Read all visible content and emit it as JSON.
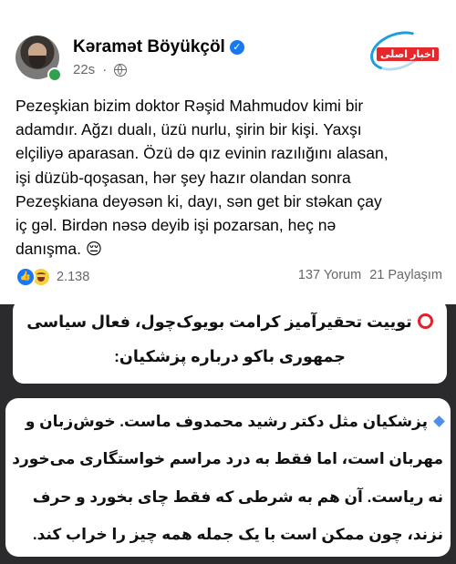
{
  "post": {
    "author": "Kəramət Böyükçöl",
    "time": "22s",
    "badge_text": "اخبار اصلی",
    "lines": [
      "Pezeşkian bizim doktor Rəşid Mahmudov kimi bir",
      "adamdır. Ağzı dualı, üzü nurlu, şirin bir kişi. Yaxşı",
      "elçiliyə aparasan. Özü də qız evinin razılığını alasan,",
      "işi düzüb-qoşasan, hər şey hazır olandan sonra",
      "Pezeşkiana deyəsən ki, dayı, sən get bir stəkan çay",
      "iç gəl. Birdən nəsə deyib işi pozarsan, heç nə",
      "danışma. 😔"
    ],
    "reaction_count": "2.138",
    "comments": "137 Yorum",
    "shares": "21 Paylaşım"
  },
  "caption": {
    "title_lines": [
      "توییت تحقیرآمیز کرامت بویوک‌چول، فعال سیاسی",
      "جمهوری باکو درباره پزشکیان:"
    ],
    "body_lines": [
      "پزشکیان مثل دکتر رشید محمدوف ماست. خوش‌زبان و",
      "مهربان است، اما فقط به درد مراسم خواستگاری می‌خورد",
      "نه ریاست. آن هم به شرطی که فقط چای بخورد و حرف",
      "نزند، چون ممکن است با یک جمله همه چیز را خراب کند."
    ]
  },
  "colors": {
    "facebook_blue": "#1877f2",
    "online_green": "#31a24c",
    "marker_red": "#e0202a",
    "background_dark": "#2b2b2e"
  },
  "icons": [
    "verified-icon",
    "globe-icon",
    "like-reaction-icon",
    "haha-reaction-icon",
    "red-circle-icon",
    "blue-diamond-icon"
  ]
}
